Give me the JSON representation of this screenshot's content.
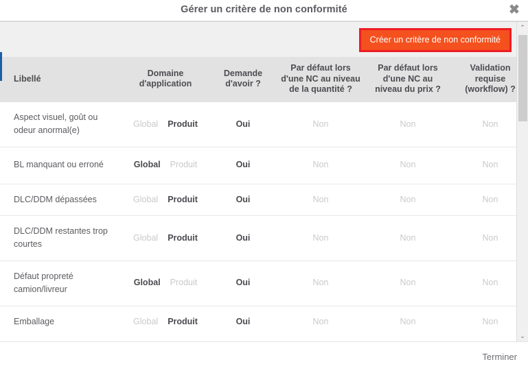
{
  "dialog": {
    "title": "Gérer un critère de non conformité",
    "close_icon": "close-icon",
    "close_glyph": "✖"
  },
  "toolbar": {
    "create_label": "Créer un critère de non conformité",
    "create_bg_color": "#f4511e",
    "highlight_color": "#ee1c25"
  },
  "table": {
    "headers": {
      "libelle": "Libellé",
      "domaine": "Domaine d'application",
      "demande": "Demande d'avoir ?",
      "defaut_quantite": "Par défaut lors d'une NC au niveau de la quantité ?",
      "defaut_prix": "Par défaut lors d'une NC au niveau du prix ?",
      "validation": "Validation requise (workflow) ?",
      "actions": ""
    },
    "rows": [
      {
        "libelle": "Aspect visuel, goût ou odeur anormal(e)",
        "domaine_global": "Global",
        "domaine_produit": "Produit",
        "domaine_active": "produit",
        "demande": "Oui",
        "demande_active": true,
        "defaut_quantite": "Non",
        "defaut_quantite_active": false,
        "defaut_prix": "Non",
        "defaut_prix_active": false,
        "validation": "Non",
        "validation_active": false,
        "edit_icon": "pencil-icon",
        "delete_icon": "delete-cross-icon",
        "highlight": "edit"
      },
      {
        "libelle": "BL manquant ou erroné",
        "domaine_global": "Global",
        "domaine_produit": "Produit",
        "domaine_active": "global",
        "demande": "Oui",
        "demande_active": true,
        "defaut_quantite": "Non",
        "defaut_quantite_active": false,
        "defaut_prix": "Non",
        "defaut_prix_active": false,
        "validation": "Non",
        "validation_active": false,
        "edit_icon": "pencil-icon",
        "delete_icon": "delete-cross-icon",
        "highlight": "delete"
      },
      {
        "libelle": "DLC/DDM dépassées",
        "domaine_global": "Global",
        "domaine_produit": "Produit",
        "domaine_active": "produit",
        "demande": "Oui",
        "demande_active": true,
        "defaut_quantite": "Non",
        "defaut_quantite_active": false,
        "defaut_prix": "Non",
        "defaut_prix_active": false,
        "validation": "Non",
        "validation_active": false,
        "edit_icon": "pencil-icon",
        "delete_icon": "delete-cross-icon",
        "highlight": "none"
      },
      {
        "libelle": "DLC/DDM restantes trop courtes",
        "domaine_global": "Global",
        "domaine_produit": "Produit",
        "domaine_active": "produit",
        "demande": "Oui",
        "demande_active": true,
        "defaut_quantite": "Non",
        "defaut_quantite_active": false,
        "defaut_prix": "Non",
        "defaut_prix_active": false,
        "validation": "Non",
        "validation_active": false,
        "edit_icon": "pencil-icon",
        "delete_icon": "delete-cross-icon",
        "highlight": "none"
      },
      {
        "libelle": "Défaut propreté camion/livreur",
        "domaine_global": "Global",
        "domaine_produit": "Produit",
        "domaine_active": "global",
        "demande": "Oui",
        "demande_active": true,
        "defaut_quantite": "Non",
        "defaut_quantite_active": false,
        "defaut_prix": "Non",
        "defaut_prix_active": false,
        "validation": "Non",
        "validation_active": false,
        "edit_icon": "pencil-icon",
        "delete_icon": "delete-cross-icon",
        "highlight": "none"
      },
      {
        "libelle": "Emballage",
        "domaine_global": "Global",
        "domaine_produit": "Produit",
        "domaine_active": "produit",
        "demande": "Oui",
        "demande_active": true,
        "defaut_quantite": "Non",
        "defaut_quantite_active": false,
        "defaut_prix": "Non",
        "defaut_prix_active": false,
        "validation": "Non",
        "validation_active": false,
        "edit_icon": "pencil-icon",
        "delete_icon": "delete-cross-icon",
        "highlight": "none"
      }
    ]
  },
  "scrollbar": {
    "up_icon": "chevron-up-icon",
    "down_icon": "chevron-down-icon",
    "up_glyph": "⌃",
    "down_glyph": "⌄"
  },
  "footer": {
    "finish_label": "Terminer"
  },
  "colors": {
    "accent_orange": "#f4511e",
    "highlight_red": "#ee1c25",
    "pencil_orange": "#f5a623",
    "delete_red": "#b5301c",
    "header_bg": "#e2e2e2",
    "body_bg": "#f0f0f0"
  }
}
